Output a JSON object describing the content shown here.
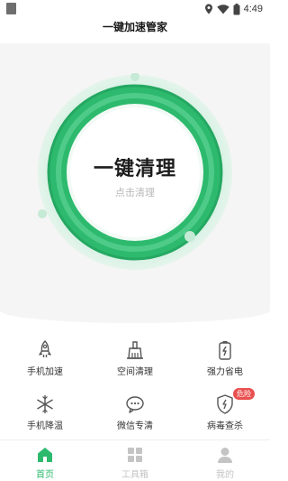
{
  "status_bar": {
    "time": "4:49",
    "icons": [
      "location-icon",
      "wifi-icon",
      "battery-icon"
    ]
  },
  "header": {
    "title": "一键加速管家"
  },
  "main": {
    "clean_button": {
      "title": "一键清理",
      "subtitle": "点击清理"
    },
    "accent_color": "#2dba6e"
  },
  "tools": [
    {
      "label": "手机加速",
      "icon": "rocket-icon"
    },
    {
      "label": "空间清理",
      "icon": "broom-icon"
    },
    {
      "label": "强力省电",
      "icon": "battery-charge-icon"
    },
    {
      "label": "手机降温",
      "icon": "snowflake-icon"
    },
    {
      "label": "微信专清",
      "icon": "wechat-icon"
    },
    {
      "label": "病毒查杀",
      "icon": "shield-icon",
      "badge": "危险"
    }
  ],
  "tab_bar": {
    "items": [
      {
        "label": "首页",
        "icon": "home-icon",
        "active": true
      },
      {
        "label": "工具箱",
        "icon": "toolbox-icon",
        "active": false
      },
      {
        "label": "我的",
        "icon": "user-icon",
        "active": false
      }
    ],
    "active_color": "#2dba6e",
    "inactive_color": "#c4c4c4"
  }
}
